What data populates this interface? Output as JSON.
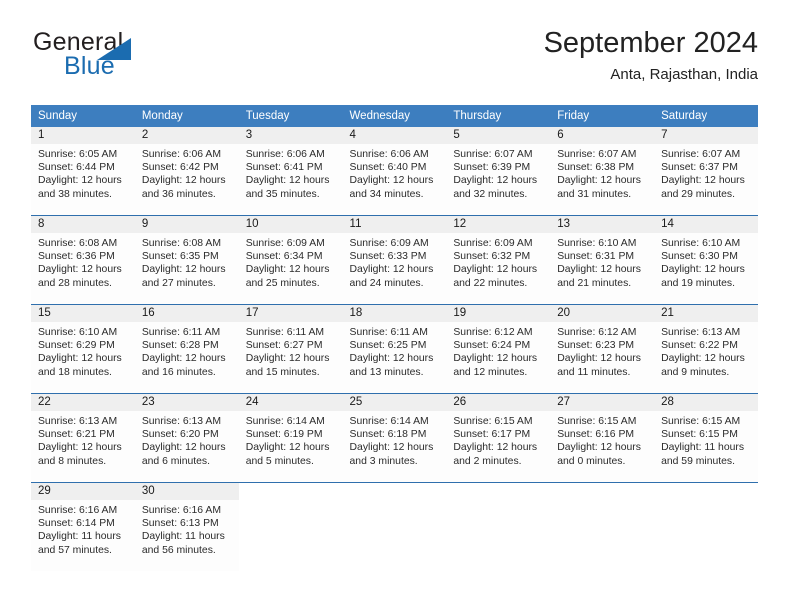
{
  "brand": {
    "name_part1": "General",
    "name_part2": "Blue",
    "flag_icon": "triangle-flag-icon"
  },
  "header": {
    "title": "September 2024",
    "location": "Anta, Rajasthan, India"
  },
  "colors": {
    "header_blue": "#3d7ebf",
    "row_separator_blue": "#2f6fad",
    "daynum_band": "#efefef",
    "brand_blue": "#1b6cb0",
    "text": "#222222"
  },
  "weekday_headers": [
    "Sunday",
    "Monday",
    "Tuesday",
    "Wednesday",
    "Thursday",
    "Friday",
    "Saturday"
  ],
  "weeks": [
    [
      {
        "day": "1",
        "sunrise": "Sunrise: 6:05 AM",
        "sunset": "Sunset: 6:44 PM",
        "daylight_line1": "Daylight: 12 hours",
        "daylight_line2": "and 38 minutes."
      },
      {
        "day": "2",
        "sunrise": "Sunrise: 6:06 AM",
        "sunset": "Sunset: 6:42 PM",
        "daylight_line1": "Daylight: 12 hours",
        "daylight_line2": "and 36 minutes."
      },
      {
        "day": "3",
        "sunrise": "Sunrise: 6:06 AM",
        "sunset": "Sunset: 6:41 PM",
        "daylight_line1": "Daylight: 12 hours",
        "daylight_line2": "and 35 minutes."
      },
      {
        "day": "4",
        "sunrise": "Sunrise: 6:06 AM",
        "sunset": "Sunset: 6:40 PM",
        "daylight_line1": "Daylight: 12 hours",
        "daylight_line2": "and 34 minutes."
      },
      {
        "day": "5",
        "sunrise": "Sunrise: 6:07 AM",
        "sunset": "Sunset: 6:39 PM",
        "daylight_line1": "Daylight: 12 hours",
        "daylight_line2": "and 32 minutes."
      },
      {
        "day": "6",
        "sunrise": "Sunrise: 6:07 AM",
        "sunset": "Sunset: 6:38 PM",
        "daylight_line1": "Daylight: 12 hours",
        "daylight_line2": "and 31 minutes."
      },
      {
        "day": "7",
        "sunrise": "Sunrise: 6:07 AM",
        "sunset": "Sunset: 6:37 PM",
        "daylight_line1": "Daylight: 12 hours",
        "daylight_line2": "and 29 minutes."
      }
    ],
    [
      {
        "day": "8",
        "sunrise": "Sunrise: 6:08 AM",
        "sunset": "Sunset: 6:36 PM",
        "daylight_line1": "Daylight: 12 hours",
        "daylight_line2": "and 28 minutes."
      },
      {
        "day": "9",
        "sunrise": "Sunrise: 6:08 AM",
        "sunset": "Sunset: 6:35 PM",
        "daylight_line1": "Daylight: 12 hours",
        "daylight_line2": "and 27 minutes."
      },
      {
        "day": "10",
        "sunrise": "Sunrise: 6:09 AM",
        "sunset": "Sunset: 6:34 PM",
        "daylight_line1": "Daylight: 12 hours",
        "daylight_line2": "and 25 minutes."
      },
      {
        "day": "11",
        "sunrise": "Sunrise: 6:09 AM",
        "sunset": "Sunset: 6:33 PM",
        "daylight_line1": "Daylight: 12 hours",
        "daylight_line2": "and 24 minutes."
      },
      {
        "day": "12",
        "sunrise": "Sunrise: 6:09 AM",
        "sunset": "Sunset: 6:32 PM",
        "daylight_line1": "Daylight: 12 hours",
        "daylight_line2": "and 22 minutes."
      },
      {
        "day": "13",
        "sunrise": "Sunrise: 6:10 AM",
        "sunset": "Sunset: 6:31 PM",
        "daylight_line1": "Daylight: 12 hours",
        "daylight_line2": "and 21 minutes."
      },
      {
        "day": "14",
        "sunrise": "Sunrise: 6:10 AM",
        "sunset": "Sunset: 6:30 PM",
        "daylight_line1": "Daylight: 12 hours",
        "daylight_line2": "and 19 minutes."
      }
    ],
    [
      {
        "day": "15",
        "sunrise": "Sunrise: 6:10 AM",
        "sunset": "Sunset: 6:29 PM",
        "daylight_line1": "Daylight: 12 hours",
        "daylight_line2": "and 18 minutes."
      },
      {
        "day": "16",
        "sunrise": "Sunrise: 6:11 AM",
        "sunset": "Sunset: 6:28 PM",
        "daylight_line1": "Daylight: 12 hours",
        "daylight_line2": "and 16 minutes."
      },
      {
        "day": "17",
        "sunrise": "Sunrise: 6:11 AM",
        "sunset": "Sunset: 6:27 PM",
        "daylight_line1": "Daylight: 12 hours",
        "daylight_line2": "and 15 minutes."
      },
      {
        "day": "18",
        "sunrise": "Sunrise: 6:11 AM",
        "sunset": "Sunset: 6:25 PM",
        "daylight_line1": "Daylight: 12 hours",
        "daylight_line2": "and 13 minutes."
      },
      {
        "day": "19",
        "sunrise": "Sunrise: 6:12 AM",
        "sunset": "Sunset: 6:24 PM",
        "daylight_line1": "Daylight: 12 hours",
        "daylight_line2": "and 12 minutes."
      },
      {
        "day": "20",
        "sunrise": "Sunrise: 6:12 AM",
        "sunset": "Sunset: 6:23 PM",
        "daylight_line1": "Daylight: 12 hours",
        "daylight_line2": "and 11 minutes."
      },
      {
        "day": "21",
        "sunrise": "Sunrise: 6:13 AM",
        "sunset": "Sunset: 6:22 PM",
        "daylight_line1": "Daylight: 12 hours",
        "daylight_line2": "and 9 minutes."
      }
    ],
    [
      {
        "day": "22",
        "sunrise": "Sunrise: 6:13 AM",
        "sunset": "Sunset: 6:21 PM",
        "daylight_line1": "Daylight: 12 hours",
        "daylight_line2": "and 8 minutes."
      },
      {
        "day": "23",
        "sunrise": "Sunrise: 6:13 AM",
        "sunset": "Sunset: 6:20 PM",
        "daylight_line1": "Daylight: 12 hours",
        "daylight_line2": "and 6 minutes."
      },
      {
        "day": "24",
        "sunrise": "Sunrise: 6:14 AM",
        "sunset": "Sunset: 6:19 PM",
        "daylight_line1": "Daylight: 12 hours",
        "daylight_line2": "and 5 minutes."
      },
      {
        "day": "25",
        "sunrise": "Sunrise: 6:14 AM",
        "sunset": "Sunset: 6:18 PM",
        "daylight_line1": "Daylight: 12 hours",
        "daylight_line2": "and 3 minutes."
      },
      {
        "day": "26",
        "sunrise": "Sunrise: 6:15 AM",
        "sunset": "Sunset: 6:17 PM",
        "daylight_line1": "Daylight: 12 hours",
        "daylight_line2": "and 2 minutes."
      },
      {
        "day": "27",
        "sunrise": "Sunrise: 6:15 AM",
        "sunset": "Sunset: 6:16 PM",
        "daylight_line1": "Daylight: 12 hours",
        "daylight_line2": "and 0 minutes."
      },
      {
        "day": "28",
        "sunrise": "Sunrise: 6:15 AM",
        "sunset": "Sunset: 6:15 PM",
        "daylight_line1": "Daylight: 11 hours",
        "daylight_line2": "and 59 minutes."
      }
    ],
    [
      {
        "day": "29",
        "sunrise": "Sunrise: 6:16 AM",
        "sunset": "Sunset: 6:14 PM",
        "daylight_line1": "Daylight: 11 hours",
        "daylight_line2": "and 57 minutes."
      },
      {
        "day": "30",
        "sunrise": "Sunrise: 6:16 AM",
        "sunset": "Sunset: 6:13 PM",
        "daylight_line1": "Daylight: 11 hours",
        "daylight_line2": "and 56 minutes."
      },
      null,
      null,
      null,
      null,
      null
    ]
  ]
}
